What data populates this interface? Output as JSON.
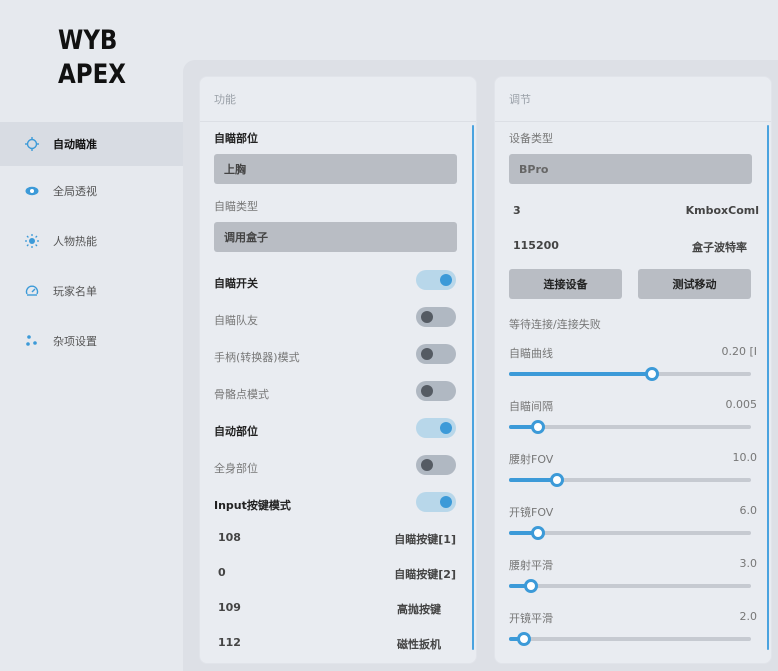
{
  "logo": {
    "line1": "WYB",
    "line2": "APEX"
  },
  "sidebar": {
    "items": [
      {
        "label": "自动瞄准",
        "icon": "crosshair-icon",
        "active": true
      },
      {
        "label": "全局透视",
        "icon": "eye-icon"
      },
      {
        "label": "人物热能",
        "icon": "sun-icon"
      },
      {
        "label": "玩家名单",
        "icon": "gauge-icon"
      },
      {
        "label": "杂项设置",
        "icon": "dots-icon"
      }
    ]
  },
  "left_panel": {
    "title": "功能",
    "aim_part_label": "自瞄部位",
    "aim_part_value": "上胸",
    "aim_type_label": "自瞄类型",
    "aim_type_value": "调用盒子",
    "toggles": [
      {
        "label": "自瞄开关",
        "on": true
      },
      {
        "label": "自瞄队友",
        "on": false
      },
      {
        "label": "手柄(转换器)模式",
        "on": false
      },
      {
        "label": "骨骼点模式",
        "on": false
      },
      {
        "label": "自动部位",
        "on": true
      },
      {
        "label": "全身部位",
        "on": false
      },
      {
        "label": "Input按键模式",
        "on": true
      }
    ],
    "keys": [
      {
        "value": "108",
        "label": "自瞄按键[1]"
      },
      {
        "value": "0",
        "label": "自瞄按键[2]"
      },
      {
        "value": "109",
        "label": "高抛按键"
      },
      {
        "value": "112",
        "label": "磁性扳机"
      }
    ]
  },
  "right_panel": {
    "title": "调节",
    "device_type_label": "设备类型",
    "device_type_value": "BPro",
    "rows": [
      {
        "value": "3",
        "label": "KmboxComl"
      },
      {
        "value": "115200",
        "label": "盒子波特率"
      }
    ],
    "connect_button": "连接设备",
    "test_button": "测试移动",
    "status": "等待连接/连接失败",
    "sliders": [
      {
        "label": "自瞄曲线",
        "value": "0.20 [I",
        "fraction": 0.59
      },
      {
        "label": "自瞄间隔",
        "value": "0.005",
        "fraction": 0.12
      },
      {
        "label": "腰射FOV",
        "value": "10.0",
        "fraction": 0.2
      },
      {
        "label": "开镜FOV",
        "value": "6.0",
        "fraction": 0.12
      },
      {
        "label": "腰射平滑",
        "value": "3.0",
        "fraction": 0.09
      },
      {
        "label": "开镜平滑",
        "value": "2.0",
        "fraction": 0.06
      }
    ]
  },
  "colors": {
    "accent": "#3c9ad8",
    "background": "#e6e9ee",
    "panel": "#e9ecf1"
  }
}
